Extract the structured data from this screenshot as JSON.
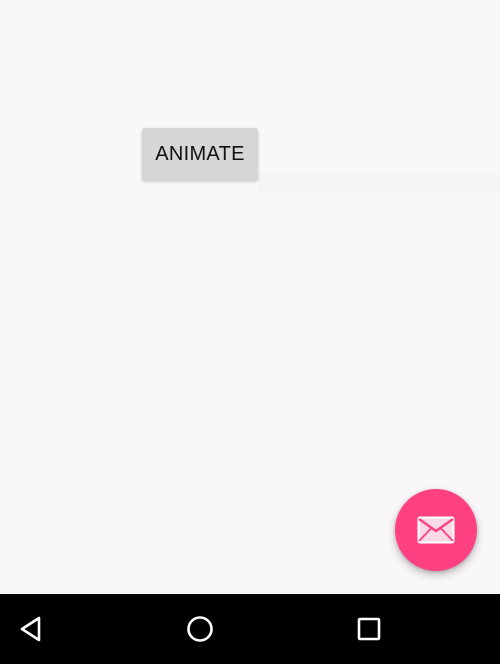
{
  "main": {
    "animate_button_label": "ANIMATE"
  },
  "fab": {
    "icon": "mail-icon",
    "color": "#ff4081"
  },
  "navigation_bar": {
    "back_icon": "back-icon",
    "home_icon": "home-icon",
    "recents_icon": "recents-icon"
  },
  "colors": {
    "background": "#faf7fa",
    "button": "#d6d6d6",
    "nav_bar": "#000000"
  }
}
